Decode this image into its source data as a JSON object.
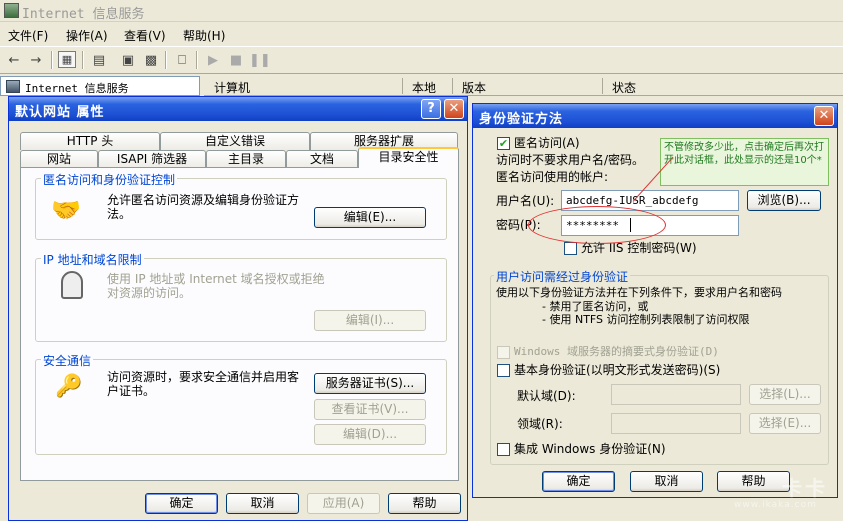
{
  "app": {
    "title": "Internet 信息服务"
  },
  "menu": [
    "文件(F)",
    "操作(A)",
    "查看(V)",
    "帮助(H)"
  ],
  "tree": {
    "item": "Internet 信息服务"
  },
  "list_columns": [
    "计算机",
    "本地",
    "版本",
    "状态"
  ],
  "props": {
    "title": "默认网站 属性",
    "help_glyph": "?",
    "close_glyph": "✕",
    "tabs_back": [
      "HTTP 头",
      "自定义错误",
      "服务器扩展"
    ],
    "tabs_front": [
      "网站",
      "ISAPI 筛选器",
      "主目录",
      "文档",
      "目录安全性"
    ],
    "anon": {
      "group": "匿名访问和身份验证控制",
      "desc": "允许匿名访问资源及编辑身份验证方法。",
      "edit": "编辑(E)..."
    },
    "ip": {
      "group": "IP 地址和域名限制",
      "desc": "使用 IP 地址或 Internet 域名授权或拒绝对资源的访问。",
      "edit": "编辑(I)..."
    },
    "secure": {
      "group": "安全通信",
      "desc": "访问资源时，要求安全通信并启用客户证书。",
      "server_cert": "服务器证书(S)...",
      "view_cert": "查看证书(V)...",
      "edit": "编辑(D)..."
    },
    "buttons": {
      "ok": "确定",
      "cancel": "取消",
      "apply": "应用(A)",
      "help": "帮助"
    }
  },
  "auth": {
    "title": "身份验证方法",
    "close_glyph": "✕",
    "anon_checkbox": "匿名访问(A)",
    "anon_checked": true,
    "desc1": "访问时不要求用户名/密码。",
    "desc2": "匿名访问使用的帐户:",
    "username_label": "用户名(U):",
    "username_value": "abcdefg-IUSR_abcdefg",
    "browse": "浏览(B)...",
    "password_label": "密码(P):",
    "password_value": "********",
    "allow_iis": "允许 IIS 控制密码(W)",
    "auth_group": "用户访问需经过身份验证",
    "auth_desc": "使用以下身份验证方法并在下列条件下，要求用户名和密码",
    "cond1": "- 禁用了匿名访问，或",
    "cond2": "- 使用 NTFS 访问控制列表限制了访问权限",
    "digest": "Windows 域服务器的摘要式身份验证(D)",
    "basic": "基本身份验证(以明文形式发送密码)(S)",
    "default_domain": "默认域(D):",
    "realm": "领域(R):",
    "select": "选择(L)...",
    "select2": "选择(E)...",
    "integrated": "集成 Windows 身份验证(N)",
    "buttons": {
      "ok": "确定",
      "cancel": "取消",
      "help": "帮助"
    }
  },
  "annotation": "不管修改多少此，点击确定后再次打开此对话框，此处显示的还是10个*",
  "watermark": {
    "brand": "卡卡",
    "url": "www.ikaka.com"
  },
  "colors": {
    "title_bar": "#1f52d6",
    "group_label": "#0046d5",
    "annotation": "#1f7a1f",
    "highlight_ring": "#e03030"
  }
}
